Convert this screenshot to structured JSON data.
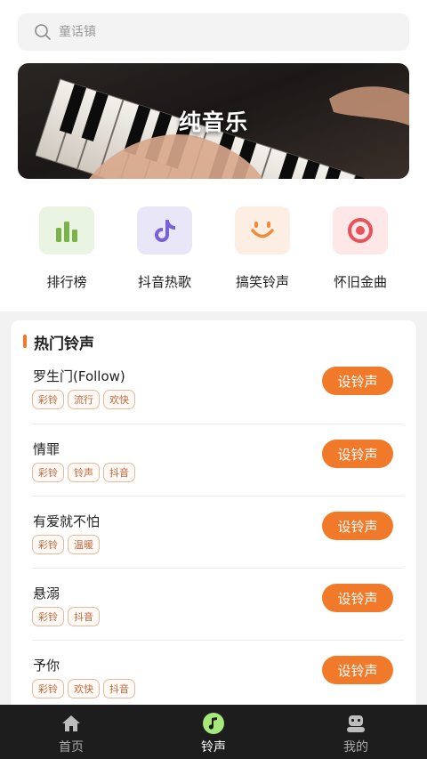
{
  "search": {
    "placeholder": "童话镇"
  },
  "banner": {
    "title": "纯音乐"
  },
  "categories": [
    {
      "label": "排行榜",
      "icon": "bar-chart-icon",
      "bg": "#eaf4e3",
      "color": "#7bb24a"
    },
    {
      "label": "抖音热歌",
      "icon": "tiktok-icon",
      "bg": "#e9e6f7",
      "color": "#7a5fd6"
    },
    {
      "label": "搞笑铃声",
      "icon": "smile-icon",
      "bg": "#fdeee4",
      "color": "#f08a3a"
    },
    {
      "label": "怀旧金曲",
      "icon": "target-icon",
      "bg": "#fde7e7",
      "color": "#e8525a"
    }
  ],
  "hot": {
    "title": "热门铃声",
    "button_label": "设铃声",
    "songs": [
      {
        "name": "罗生门(Follow)",
        "tags": [
          "彩铃",
          "流行",
          "欢快"
        ]
      },
      {
        "name": "情罪",
        "tags": [
          "彩铃",
          "铃声",
          "抖音"
        ]
      },
      {
        "name": "有爱就不怕",
        "tags": [
          "彩铃",
          "温暖"
        ]
      },
      {
        "name": "悬溺",
        "tags": [
          "彩铃",
          "抖音"
        ]
      },
      {
        "name": "予你",
        "tags": [
          "彩铃",
          "欢快",
          "抖音"
        ]
      }
    ]
  },
  "tabs": [
    {
      "label": "首页",
      "icon": "home-icon",
      "active": false
    },
    {
      "label": "铃声",
      "icon": "music-note-icon",
      "active": true
    },
    {
      "label": "我的",
      "icon": "user-icon",
      "active": false
    }
  ],
  "colors": {
    "accent": "#f07a2a",
    "tabbar": "#1d1d1d",
    "active_tab_icon": "#a6e87a"
  }
}
